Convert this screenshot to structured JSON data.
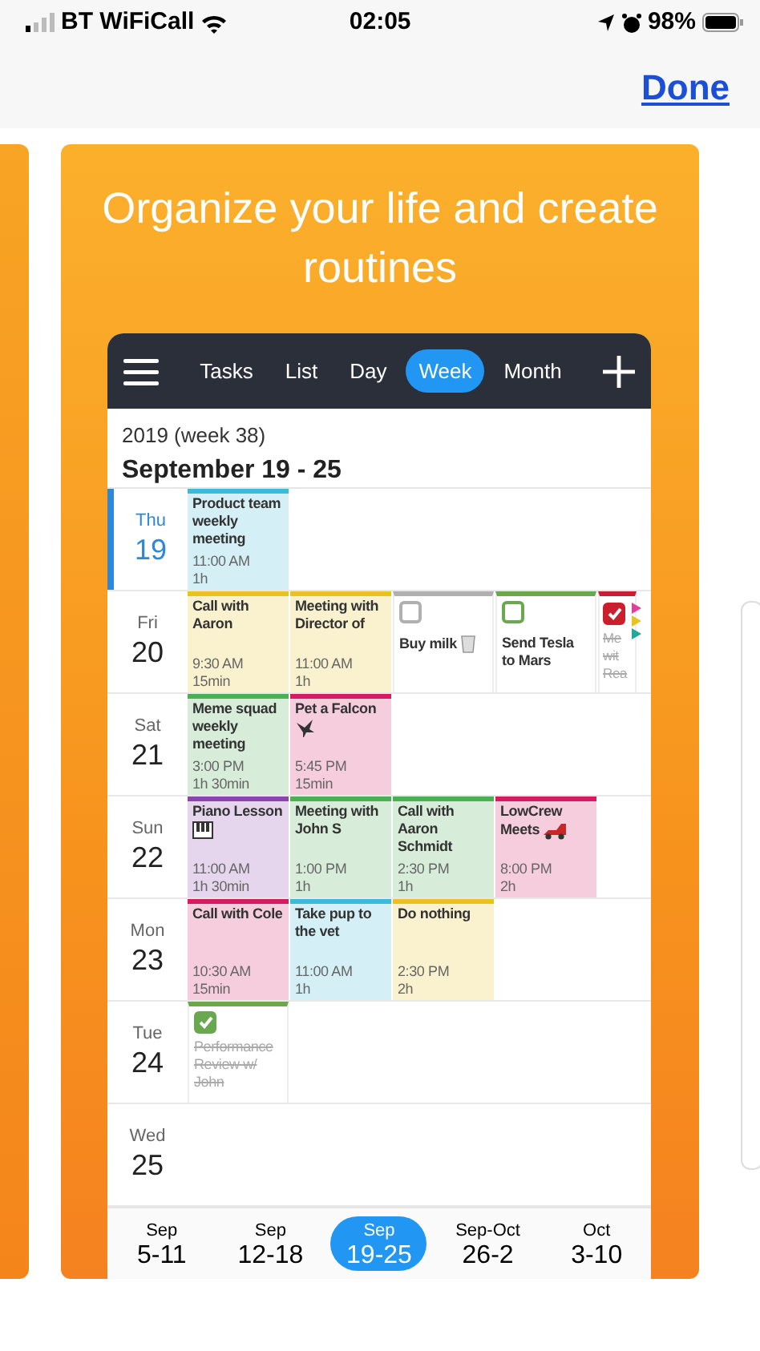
{
  "status_bar": {
    "carrier": "BT WiFiCall",
    "time": "02:05",
    "battery": "98%"
  },
  "header": {
    "done": "Done"
  },
  "promo": {
    "title": "Organize your life and create routines"
  },
  "app": {
    "tabs": [
      {
        "label": "Tasks",
        "selected": false
      },
      {
        "label": "List",
        "selected": false
      },
      {
        "label": "Day",
        "selected": false
      },
      {
        "label": "Week",
        "selected": true
      },
      {
        "label": "Month",
        "selected": false
      }
    ],
    "week_label": "2019 (week 38)",
    "range": "September 19 - 25",
    "days": [
      {
        "weekday": "Thu",
        "date": "19",
        "selected": true,
        "items": [
          {
            "kind": "event",
            "title": "Product team weekly meeting",
            "time": "11:00 AM",
            "duration": "1h",
            "color": "#3bbcd6"
          }
        ]
      },
      {
        "weekday": "Fri",
        "date": "20",
        "selected": false,
        "items": [
          {
            "kind": "event",
            "title": "Call with Aaron",
            "time": "9:30 AM",
            "duration": "15min",
            "color": "#e8c21e"
          },
          {
            "kind": "event",
            "title": "Meeting with Director of",
            "time": "11:00 AM",
            "duration": "1h",
            "color": "#e8c21e"
          },
          {
            "kind": "task",
            "title": "Buy milk",
            "checked": false,
            "color": "#b0b0b0"
          },
          {
            "kind": "task",
            "title": "Send Tesla to Mars",
            "checked": false,
            "color": "#6aa84f"
          },
          {
            "kind": "task",
            "title": "Me wit Rea",
            "checked": true,
            "color": "#cc1f2d"
          }
        ],
        "flags": [
          {
            "color": "#e0409a"
          },
          {
            "color": "#e8c21e"
          },
          {
            "color": "#1fa99a"
          }
        ]
      },
      {
        "weekday": "Sat",
        "date": "21",
        "selected": false,
        "items": [
          {
            "kind": "event",
            "title": "Meme squad weekly meeting",
            "time": "3:00 PM",
            "duration": "1h 30min",
            "color": "#4caf50"
          },
          {
            "kind": "event",
            "title": "Pet a Falcon",
            "time": "5:45 PM",
            "duration": "15min",
            "color": "#d81b60"
          }
        ]
      },
      {
        "weekday": "Sun",
        "date": "22",
        "selected": false,
        "items": [
          {
            "kind": "event",
            "title": "Piano Lesson",
            "time": "11:00 AM",
            "duration": "1h 30min",
            "color": "#8e44ad"
          },
          {
            "kind": "event",
            "title": "Meeting with John S",
            "time": "1:00 PM",
            "duration": "1h",
            "color": "#4caf50"
          },
          {
            "kind": "event",
            "title": "Call with Aaron Schmidt",
            "time": "2:30 PM",
            "duration": "1h",
            "color": "#4caf50"
          },
          {
            "kind": "event",
            "title": "LowCrew Meets",
            "time": "8:00 PM",
            "duration": "2h",
            "color": "#d81b60"
          }
        ]
      },
      {
        "weekday": "Mon",
        "date": "23",
        "selected": false,
        "items": [
          {
            "kind": "event",
            "title": "Call with Cole",
            "time": "10:30 AM",
            "duration": "15min",
            "color": "#d81b60"
          },
          {
            "kind": "event",
            "title": "Take pup to the vet",
            "time": "11:00 AM",
            "duration": "1h",
            "color": "#3bbcd6"
          },
          {
            "kind": "event",
            "title": "Do nothing",
            "time": "2:30 PM",
            "duration": "2h",
            "color": "#e8c21e"
          }
        ]
      },
      {
        "weekday": "Tue",
        "date": "24",
        "selected": false,
        "items": [
          {
            "kind": "task",
            "title": "Performance Review w/ John",
            "checked": true,
            "color": "#6aa84f"
          }
        ]
      },
      {
        "weekday": "Wed",
        "date": "25",
        "selected": false
      }
    ],
    "weeks": [
      {
        "month": "Sep",
        "range": "5-11",
        "selected": false
      },
      {
        "month": "Sep",
        "range": "12-18",
        "selected": false
      },
      {
        "month": "Sep",
        "range": "19-25",
        "selected": true
      },
      {
        "month": "Sep-Oct",
        "range": "26-2",
        "selected": false
      },
      {
        "month": "Oct",
        "range": "3-10",
        "selected": false
      }
    ]
  }
}
